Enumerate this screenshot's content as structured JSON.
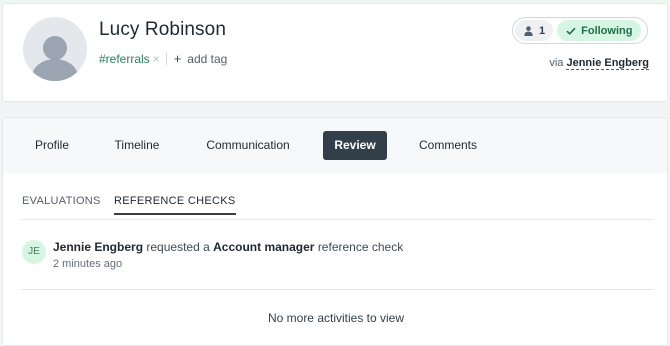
{
  "profile": {
    "name": "Lucy Robinson",
    "tag": "#referrals",
    "tag_remove": "×",
    "add_tag_icon": "+",
    "add_tag": "add tag",
    "followers_count": "1",
    "following_label": "Following",
    "via_prefix": "via",
    "via_name": "Jennie Engberg"
  },
  "tabs": [
    {
      "label": "Profile"
    },
    {
      "label": "Timeline"
    },
    {
      "label": "Communication"
    },
    {
      "label": "Review",
      "active": true
    },
    {
      "label": "Comments"
    }
  ],
  "subtabs": [
    {
      "label": "EVALUATIONS"
    },
    {
      "label": "REFERENCE CHECKS",
      "active": true
    }
  ],
  "activity": {
    "initials": "JE",
    "actor": "Jennie Engberg",
    "verb": "requested a",
    "object": "Account manager",
    "suffix": "reference check",
    "time": "2 minutes ago"
  },
  "footer_text": "No more activities to view",
  "colors": {
    "accent_green": "#23855a",
    "following_bg": "#d6f5e3",
    "active_tab_bg": "#323f4b"
  },
  "icons": {
    "follower": "user-icon",
    "following": "check-icon",
    "avatar": "avatar-placeholder-icon"
  }
}
